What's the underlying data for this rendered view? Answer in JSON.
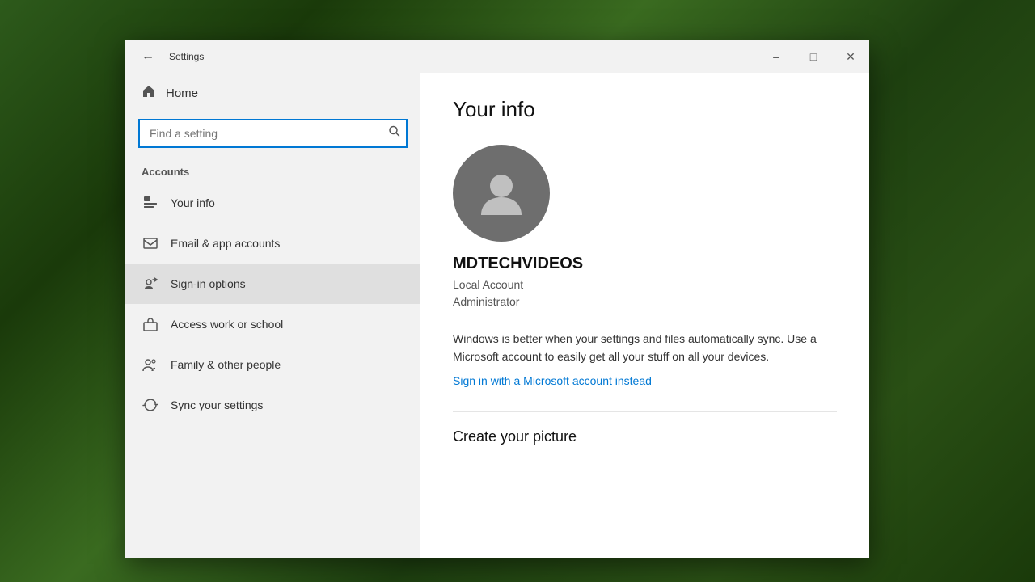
{
  "desktop": {
    "bg": "forest"
  },
  "window": {
    "title": "Settings",
    "controls": {
      "minimize": "–",
      "maximize": "□",
      "close": "✕"
    }
  },
  "sidebar": {
    "back_icon": "←",
    "home_label": "Home",
    "search_placeholder": "Find a setting",
    "search_icon": "🔍",
    "section_label": "Accounts",
    "nav_items": [
      {
        "id": "your-info",
        "label": "Your info",
        "icon": "person-card"
      },
      {
        "id": "email-app",
        "label": "Email & app accounts",
        "icon": "email"
      },
      {
        "id": "sign-in",
        "label": "Sign-in options",
        "icon": "key",
        "hovered": true
      },
      {
        "id": "access-work",
        "label": "Access work or school",
        "icon": "briefcase"
      },
      {
        "id": "family",
        "label": "Family & other people",
        "icon": "people"
      },
      {
        "id": "sync",
        "label": "Sync your settings",
        "icon": "sync"
      }
    ]
  },
  "main": {
    "page_title": "Your info",
    "avatar_alt": "User avatar",
    "username": "MDTECHVIDEOS",
    "account_line1": "Local Account",
    "account_line2": "Administrator",
    "sync_text": "Windows is better when your settings and files automatically sync. Use a Microsoft account to easily get all your stuff on all your devices.",
    "ms_link_label": "Sign in with a Microsoft account instead",
    "section2_title": "Create your picture"
  }
}
